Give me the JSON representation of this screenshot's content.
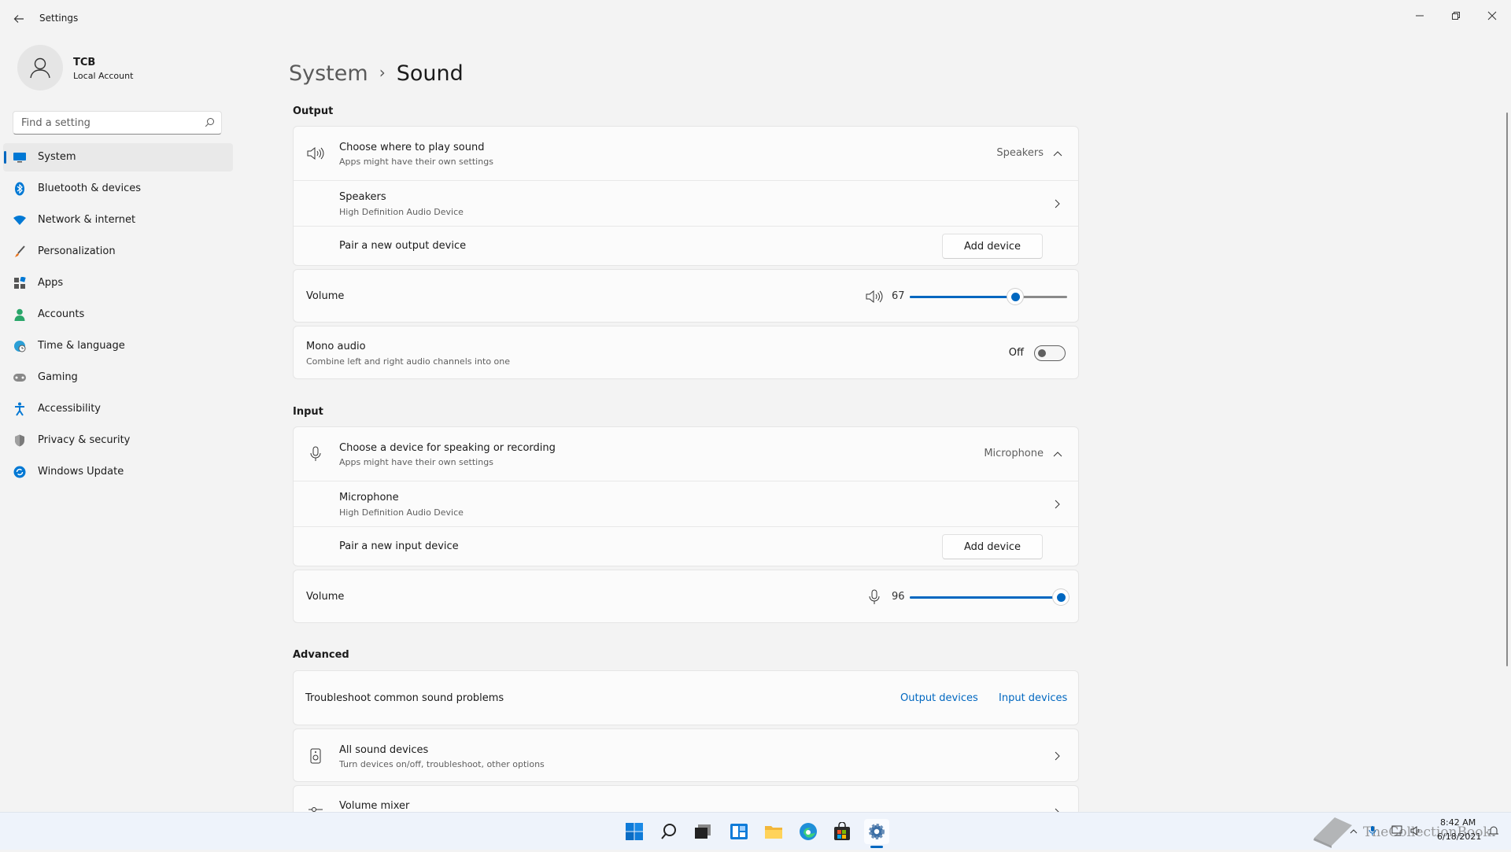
{
  "window": {
    "title": "Settings"
  },
  "profile": {
    "name": "TCB",
    "account_type": "Local Account"
  },
  "search": {
    "placeholder": "Find a setting"
  },
  "sidebar": {
    "items": [
      {
        "label": "System",
        "icon": "monitor-icon",
        "active": true
      },
      {
        "label": "Bluetooth & devices",
        "icon": "bluetooth-icon"
      },
      {
        "label": "Network & internet",
        "icon": "wifi-icon"
      },
      {
        "label": "Personalization",
        "icon": "brush-icon"
      },
      {
        "label": "Apps",
        "icon": "apps-icon"
      },
      {
        "label": "Accounts",
        "icon": "person-icon"
      },
      {
        "label": "Time & language",
        "icon": "globe-clock-icon"
      },
      {
        "label": "Gaming",
        "icon": "gamepad-icon"
      },
      {
        "label": "Accessibility",
        "icon": "accessibility-icon"
      },
      {
        "label": "Privacy & security",
        "icon": "shield-icon"
      },
      {
        "label": "Windows Update",
        "icon": "update-icon"
      }
    ]
  },
  "breadcrumb": {
    "parent": "System",
    "separator": "›",
    "current": "Sound"
  },
  "output": {
    "section_title": "Output",
    "choose": {
      "title": "Choose where to play sound",
      "subtitle": "Apps might have their own settings",
      "selected": "Speakers"
    },
    "device": {
      "name": "Speakers",
      "description": "High Definition Audio Device"
    },
    "pair": {
      "label": "Pair a new output device",
      "button": "Add device"
    },
    "volume": {
      "label": "Volume",
      "value": "67",
      "level": 67
    },
    "mono": {
      "title": "Mono audio",
      "subtitle": "Combine left and right audio channels into one",
      "state": "Off"
    }
  },
  "input": {
    "section_title": "Input",
    "choose": {
      "title": "Choose a device for speaking or recording",
      "subtitle": "Apps might have their own settings",
      "selected": "Microphone"
    },
    "device": {
      "name": "Microphone",
      "description": "High Definition Audio Device"
    },
    "pair": {
      "label": "Pair a new input device",
      "button": "Add device"
    },
    "volume": {
      "label": "Volume",
      "value": "96",
      "level": 96
    }
  },
  "advanced": {
    "section_title": "Advanced",
    "troubleshoot": {
      "label": "Troubleshoot common sound problems",
      "link_output": "Output devices",
      "link_input": "Input devices"
    },
    "all_devices": {
      "title": "All sound devices",
      "subtitle": "Turn devices on/off, troubleshoot, other options"
    },
    "mixer": {
      "title": "Volume mixer"
    }
  },
  "taskbar": {
    "time": "8:42 AM",
    "date": "6/18/2021",
    "watermark": "TheCollectionBook"
  },
  "colors": {
    "accent": "#0067c0",
    "background": "#f3f3f3",
    "card": "#fbfbfb"
  }
}
